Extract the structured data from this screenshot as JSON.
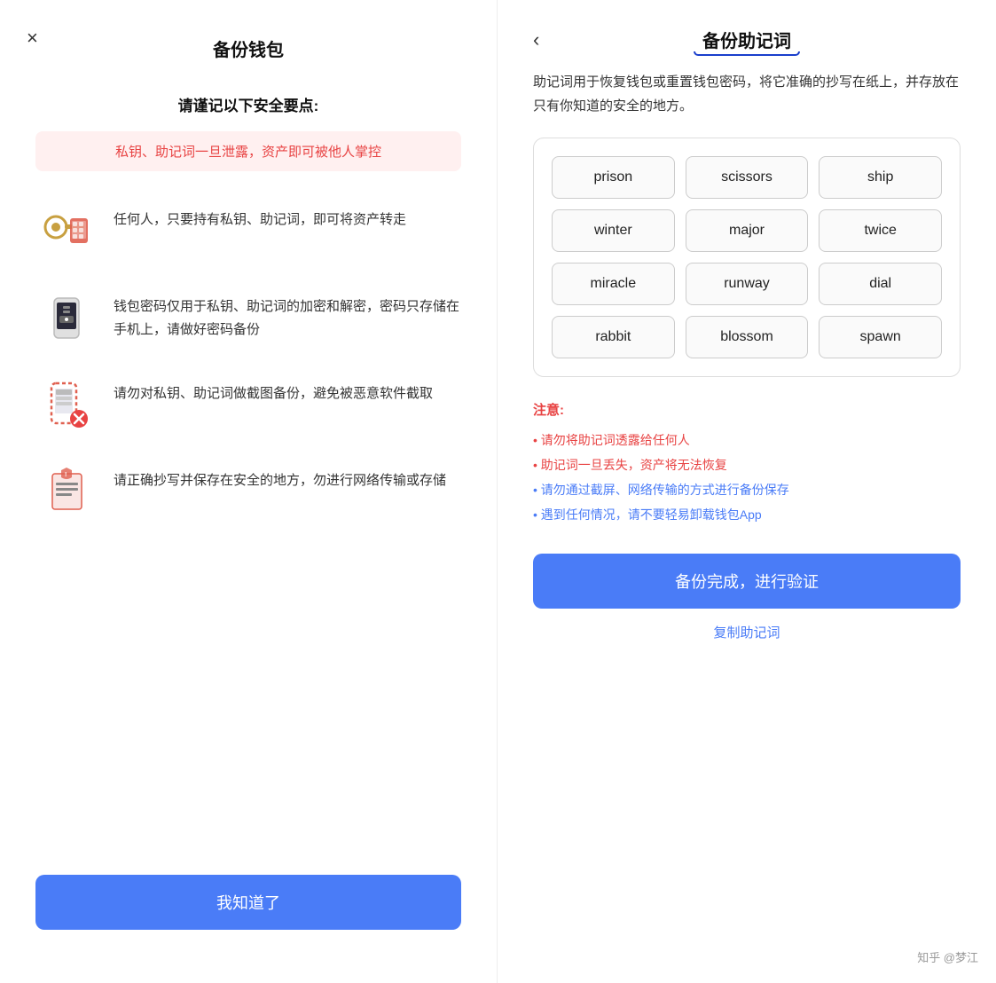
{
  "left": {
    "close_icon": "×",
    "title": "备份钱包",
    "subtitle": "请谨记以下安全要点:",
    "warning_text": "私钥、助记词一旦泄露，资产即可被他人掌控",
    "features": [
      {
        "icon": "key-phone-icon",
        "text": "任何人，只要持有私钥、助记词，即可将资产转走"
      },
      {
        "icon": "phone-password-icon",
        "text": "钱包密码仅用于私钥、助记词的加密和解密，密码只存储在手机上，请做好密码备份"
      },
      {
        "icon": "screenshot-icon",
        "text": "请勿对私钥、助记词做截图备份，避免被恶意软件截取"
      },
      {
        "icon": "save-document-icon",
        "text": "请正确抄写并保存在安全的地方，勿进行网络传输或存储"
      }
    ],
    "bottom_button": "我知道了"
  },
  "right": {
    "back_icon": "‹",
    "title": "备份助记词",
    "description": "助记词用于恢复钱包或重置钱包密码，将它准确的抄写在纸上，并存放在只有你知道的安全的地方。",
    "mnemonic_words": [
      "prison",
      "scissors",
      "ship",
      "winter",
      "major",
      "twice",
      "miracle",
      "runway",
      "dial",
      "rabbit",
      "blossom",
      "spawn"
    ],
    "notes_title": "注意:",
    "notes": [
      {
        "text": "• 请勿将助记词透露给任何人",
        "color": "red"
      },
      {
        "text": "• 助记词一旦丢失，资产将无法恢复",
        "color": "red"
      },
      {
        "text": "• 请勿通过截屏、网络传输的方式进行备份保存",
        "color": "blue"
      },
      {
        "text": "• 遇到任何情况，请不要轻易卸载钱包App",
        "color": "blue"
      }
    ],
    "main_button": "备份完成，进行验证",
    "copy_link": "复制助记词"
  },
  "watermark": "知乎 @梦江"
}
